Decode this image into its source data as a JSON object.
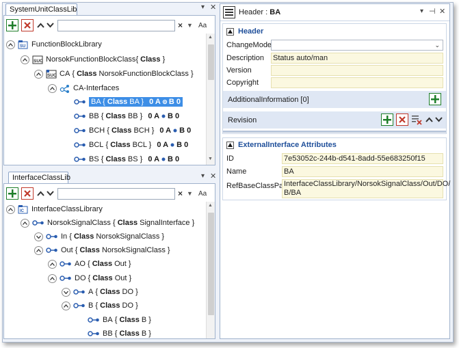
{
  "left_top": {
    "tab_label": "SystemUnitClassLib",
    "tree": [
      {
        "name": "FunctionBlockLibrary",
        "type": "",
        "suffix": ""
      },
      {
        "name": "NorsokFunctionBlockClass",
        "pre": "{ ",
        "type": "Class",
        "post": " }",
        "suffix": ""
      },
      {
        "name": "CA",
        "pre": " { ",
        "type": "Class",
        "post": " NorsokFunctionBlockClass }",
        "suffix": ""
      },
      {
        "name": "CA-Interfaces",
        "type": "",
        "suffix": ""
      },
      {
        "name": "BA",
        "pre": " { ",
        "type": "Class",
        "post": " BA }",
        "suffix_a": "0 A",
        "suffix_b": "B 0"
      },
      {
        "name": "BB",
        "pre": " { ",
        "type": "Class",
        "post": " BB }",
        "suffix_a": "0 A",
        "suffix_b": "B 0"
      },
      {
        "name": "BCH",
        "pre": " { ",
        "type": "Class",
        "post": " BCH }",
        "suffix_a": "0 A",
        "suffix_b": "B 0"
      },
      {
        "name": "BCL",
        "pre": " { ",
        "type": "Class",
        "post": " BCL }",
        "suffix_a": "0 A",
        "suffix_b": "B 0"
      },
      {
        "name": "BS",
        "pre": " { ",
        "type": "Class",
        "post": " BS }",
        "suffix_a": "0 A",
        "suffix_b": "B 0"
      }
    ]
  },
  "left_bottom": {
    "tab_label": "InterfaceClassLib",
    "tree": [
      {
        "name": "InterfaceClassLibrary",
        "pre": "",
        "type": "",
        "post": ""
      },
      {
        "name": "NorsokSignalClass",
        "pre": " { ",
        "type": "Class",
        "post": " SignalInterface }"
      },
      {
        "name": "In",
        "pre": " { ",
        "type": "Class",
        "post": " NorsokSignalClass }"
      },
      {
        "name": "Out",
        "pre": " { ",
        "type": "Class",
        "post": " NorsokSignalClass }"
      },
      {
        "name": "AO",
        "pre": " { ",
        "type": "Class",
        "post": " Out }"
      },
      {
        "name": "DO",
        "pre": " { ",
        "type": "Class",
        "post": " Out }"
      },
      {
        "name": "A",
        "pre": " { ",
        "type": "Class",
        "post": " DO }"
      },
      {
        "name": "B",
        "pre": " { ",
        "type": "Class",
        "post": " DO }"
      },
      {
        "name": "BA",
        "pre": " { ",
        "type": "Class",
        "post": " B }"
      },
      {
        "name": "BB",
        "pre": " { ",
        "type": "Class",
        "post": " B }"
      }
    ]
  },
  "right": {
    "header_prefix": "Header : ",
    "header_name": "BA",
    "section_header": "Header",
    "labels": {
      "changemode": "ChangeMode",
      "description": "Description",
      "version": "Version",
      "copyright": "Copyright"
    },
    "values": {
      "changemode": "",
      "description": "Status auto/man",
      "version": "",
      "copyright": ""
    },
    "additional_info": "AdditionalInformation [0]",
    "revision": "Revision",
    "section_ext": "ExternalInterface Attributes",
    "ext_labels": {
      "id": "ID",
      "name": "Name",
      "refbase": "RefBaseClassPath"
    },
    "ext_values": {
      "id": "7e53052c-244b-d541-8add-55e683250f15",
      "name": "BA",
      "refbase_line1": "InterfaceClassLibrary/NorsokSignalClass/Out/DO/",
      "refbase_line2": "B/BA"
    }
  },
  "colors": {
    "accent": "#3d8ee6",
    "add_green": "#1e7e2a",
    "delete_red": "#c0392b",
    "section_blue": "#1f4f9a",
    "value_bg": "#fbf8e0"
  }
}
